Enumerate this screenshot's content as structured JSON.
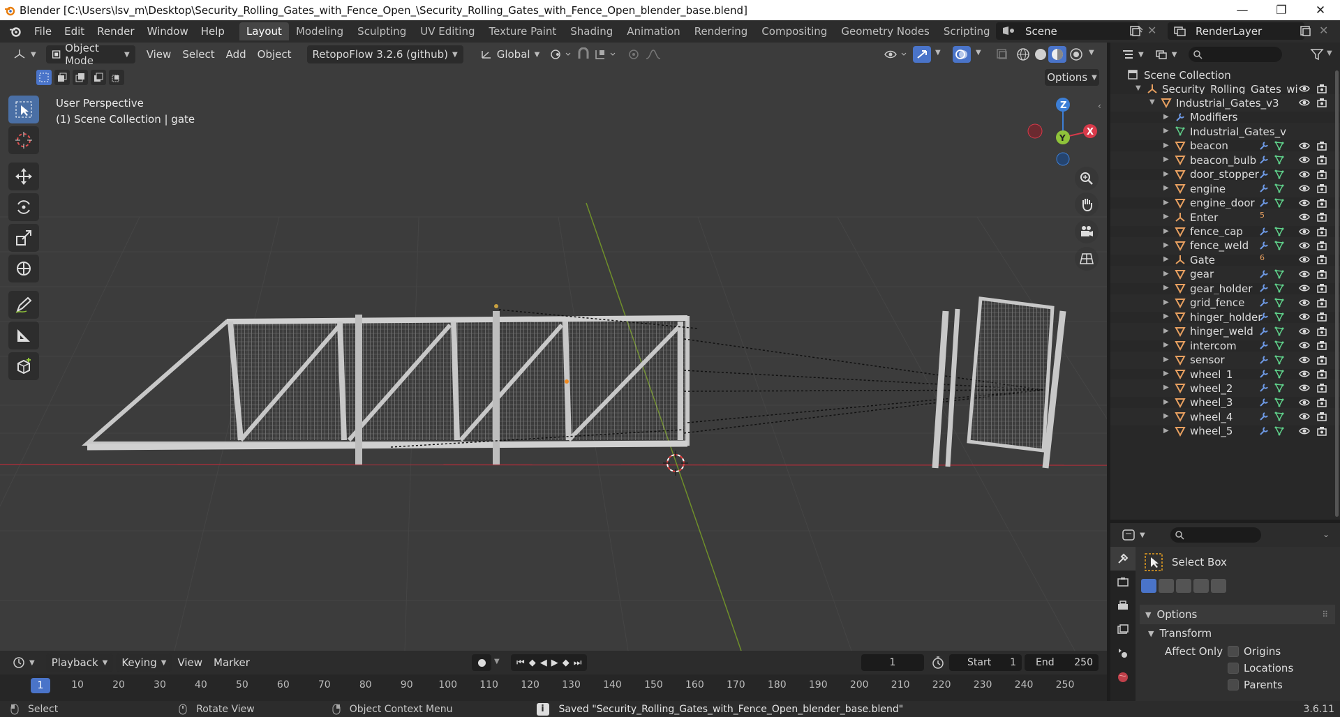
{
  "window": {
    "title": "Blender [C:\\Users\\lsv_m\\Desktop\\Security_Rolling_Gates_with_Fence_Open_\\Security_Rolling_Gates_with_Fence_Open_blender_base.blend]",
    "minimize": "—",
    "maximize": "❐",
    "close": "✕"
  },
  "menu": {
    "items": [
      "File",
      "Edit",
      "Render",
      "Window",
      "Help"
    ],
    "workspaces": [
      "Layout",
      "Modeling",
      "Sculpting",
      "UV Editing",
      "Texture Paint",
      "Shading",
      "Animation",
      "Rendering",
      "Compositing",
      "Geometry Nodes",
      "Scripting"
    ],
    "active_workspace": "Layout",
    "add_workspace": "+",
    "scene": "Scene",
    "view_layer": "RenderLayer"
  },
  "viewport": {
    "mode": "Object Mode",
    "menus": [
      "View",
      "Select",
      "Add",
      "Object"
    ],
    "addon": "RetopoFlow 3.2.6 (github)",
    "orientation": "Global",
    "options": "Options",
    "perspective": "User Perspective",
    "collection_info": "(1) Scene Collection | gate",
    "gizmo": {
      "z": "Z",
      "x": "X",
      "y": "Y"
    }
  },
  "timeline": {
    "menus": [
      "Playback",
      "Keying",
      "View",
      "Marker"
    ],
    "current_frame": "1",
    "start_label": "Start",
    "start": "1",
    "end_label": "End",
    "end": "250",
    "ruler_frames": [
      "1",
      "10",
      "20",
      "30",
      "40",
      "50",
      "60",
      "70",
      "80",
      "90",
      "100",
      "110",
      "120",
      "130",
      "140",
      "150",
      "160",
      "170",
      "180",
      "190",
      "200",
      "210",
      "220",
      "230",
      "240",
      "250"
    ]
  },
  "status": {
    "select": "Select",
    "rotate": "Rotate View",
    "context": "Object Context Menu",
    "message": "Saved \"Security_Rolling_Gates_with_Fence_Open_blender_base.blend\"",
    "version": "3.6.11"
  },
  "outliner": {
    "root": "Scene Collection",
    "rows": [
      {
        "label": "Security_Rolling_Gates_wi",
        "indent": 1,
        "icon": "empty",
        "expanded": true
      },
      {
        "label": "Industrial_Gates_v3",
        "indent": 2,
        "icon": "mesh",
        "expanded": true
      },
      {
        "label": "Modifiers",
        "indent": 3,
        "icon": "wrench",
        "expanded": false
      },
      {
        "label": "Industrial_Gates_v",
        "indent": 3,
        "icon": "meshdata",
        "expanded": false
      },
      {
        "label": "beacon",
        "indent": 3,
        "icon": "mesh",
        "expanded": false
      },
      {
        "label": "beacon_bulb",
        "indent": 3,
        "icon": "mesh",
        "expanded": false
      },
      {
        "label": "door_stopper",
        "indent": 3,
        "icon": "mesh",
        "expanded": false
      },
      {
        "label": "engine",
        "indent": 3,
        "icon": "mesh",
        "expanded": false
      },
      {
        "label": "engine_door",
        "indent": 3,
        "icon": "mesh",
        "expanded": false
      },
      {
        "label": "Enter",
        "indent": 3,
        "icon": "empty",
        "expanded": false,
        "badge": "5"
      },
      {
        "label": "fence_cap",
        "indent": 3,
        "icon": "mesh",
        "expanded": false
      },
      {
        "label": "fence_weld",
        "indent": 3,
        "icon": "mesh",
        "expanded": false
      },
      {
        "label": "Gate",
        "indent": 3,
        "icon": "empty",
        "expanded": false,
        "badge": "6"
      },
      {
        "label": "gear",
        "indent": 3,
        "icon": "mesh",
        "expanded": false
      },
      {
        "label": "gear_holder",
        "indent": 3,
        "icon": "mesh",
        "expanded": false
      },
      {
        "label": "grid_fence",
        "indent": 3,
        "icon": "mesh",
        "expanded": false
      },
      {
        "label": "hinger_holder",
        "indent": 3,
        "icon": "mesh",
        "expanded": false
      },
      {
        "label": "hinger_weld",
        "indent": 3,
        "icon": "mesh",
        "expanded": false
      },
      {
        "label": "intercom",
        "indent": 3,
        "icon": "mesh",
        "expanded": false
      },
      {
        "label": "sensor",
        "indent": 3,
        "icon": "mesh",
        "expanded": false
      },
      {
        "label": "wheel_1",
        "indent": 3,
        "icon": "mesh",
        "expanded": false
      },
      {
        "label": "wheel_2",
        "indent": 3,
        "icon": "mesh",
        "expanded": false
      },
      {
        "label": "wheel_3",
        "indent": 3,
        "icon": "mesh",
        "expanded": false
      },
      {
        "label": "wheel_4",
        "indent": 3,
        "icon": "mesh",
        "expanded": false
      },
      {
        "label": "wheel_5",
        "indent": 3,
        "icon": "mesh",
        "expanded": false
      }
    ]
  },
  "properties": {
    "tool_name": "Select Box",
    "options": "Options",
    "transform": "Transform",
    "affect_only": "Affect Only",
    "origins": "Origins",
    "locations": "Locations",
    "parents": "Parents"
  },
  "colors": {
    "accent": "#4a74c9",
    "mesh_icon": "#e8a060",
    "modifier_icon": "#6e9ae6",
    "meshdata_icon": "#5fd08a",
    "axis_x": "#d83a4a",
    "axis_y": "#8fc33a",
    "axis_z": "#3d7fd6"
  }
}
